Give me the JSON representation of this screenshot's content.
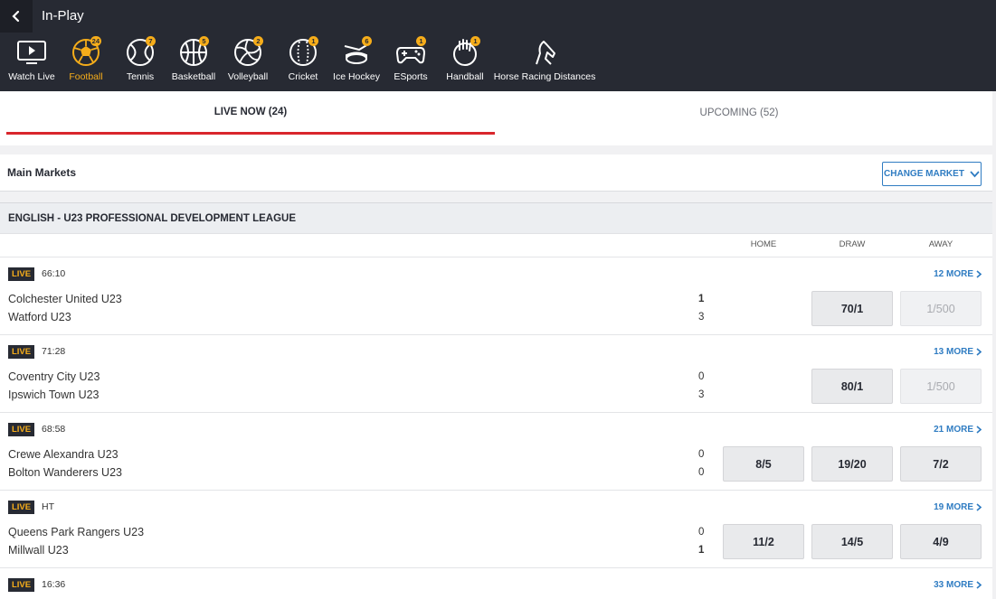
{
  "header": {
    "title": "In-Play"
  },
  "sports": [
    {
      "label": "Watch Live",
      "icon": "tv-icon",
      "count": ""
    },
    {
      "label": "Football",
      "icon": "football-icon",
      "count": "24",
      "active": true
    },
    {
      "label": "Tennis",
      "icon": "tennis-icon",
      "count": "7"
    },
    {
      "label": "Basketball",
      "icon": "basketball-icon",
      "count": "5"
    },
    {
      "label": "Volleyball",
      "icon": "volleyball-icon",
      "count": "2"
    },
    {
      "label": "Cricket",
      "icon": "cricket-icon",
      "count": "1"
    },
    {
      "label": "Ice Hockey",
      "icon": "ice-hockey-icon",
      "count": "6"
    },
    {
      "label": "ESports",
      "icon": "gamepad-icon",
      "count": "1"
    },
    {
      "label": "Handball",
      "icon": "handball-icon",
      "count": "1"
    },
    {
      "label": "Horse Racing Distances",
      "icon": "horse-icon",
      "count": ""
    }
  ],
  "tabs": {
    "live": "LIVE NOW (24)",
    "upcoming": "UPCOMING (52)"
  },
  "markets": {
    "title": "Main Markets",
    "change_label": "CHANGE MARKET"
  },
  "league": {
    "title": "ENGLISH - U23 PROFESSIONAL DEVELOPMENT LEAGUE",
    "columns": [
      "HOME",
      "DRAW",
      "AWAY"
    ]
  },
  "events": [
    {
      "status": "LIVE",
      "time": "66:10",
      "more": "12 MORE",
      "home": "Colchester United U23",
      "away": "Watford U23",
      "home_score": "1",
      "away_score": "3",
      "odds": [
        "",
        "70/1",
        "1/500"
      ]
    },
    {
      "status": "LIVE",
      "time": "71:28",
      "more": "13 MORE",
      "home": "Coventry City U23",
      "away": "Ipswich Town U23",
      "home_score": "0",
      "away_score": "3",
      "odds": [
        "",
        "80/1",
        "1/500"
      ]
    },
    {
      "status": "LIVE",
      "time": "68:58",
      "more": "21 MORE",
      "home": "Crewe Alexandra U23",
      "away": "Bolton Wanderers U23",
      "home_score": "0",
      "away_score": "0",
      "odds": [
        "8/5",
        "19/20",
        "7/2"
      ]
    },
    {
      "status": "LIVE",
      "time": "HT",
      "more": "19 MORE",
      "home": "Queens Park Rangers U23",
      "away": "Millwall U23",
      "home_score": "0",
      "away_score": "1",
      "odds": [
        "11/2",
        "14/5",
        "4/9"
      ]
    },
    {
      "status": "LIVE",
      "time": "16:36",
      "more": "33 MORE"
    }
  ],
  "colors": {
    "header_bg": "#272a33",
    "accent": "#f6ad1a",
    "tab_underline": "#d9262c",
    "link": "#2f7cc2"
  }
}
